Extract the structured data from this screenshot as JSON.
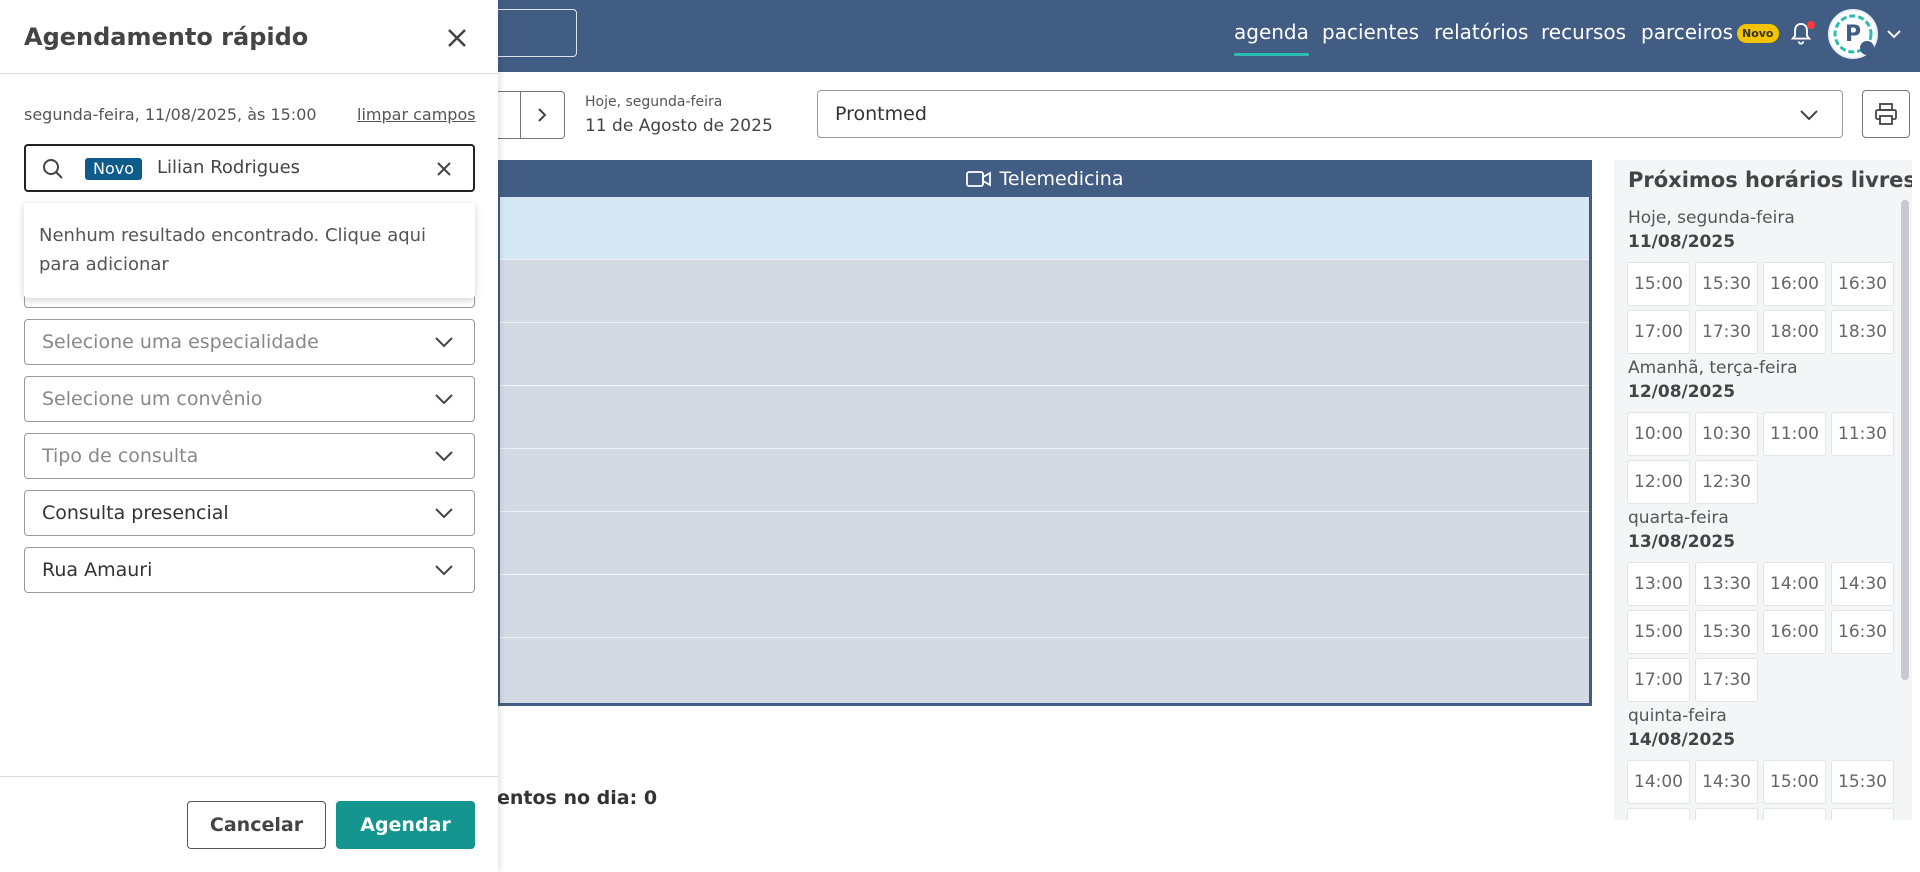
{
  "topnav": {
    "items": [
      "agenda",
      "pacientes",
      "relatórios",
      "recursos",
      "parceiros"
    ],
    "new_badge": "Novo"
  },
  "toolbar": {
    "today_label": "Hoje, segunda-feira",
    "today_date": "11 de Agosto de 2025",
    "clinic": "Prontmed"
  },
  "calendar": {
    "header": "Telemedicina",
    "day_count": "entos no dia: 0"
  },
  "free_slots": {
    "title": "Próximos horários livres",
    "days": [
      {
        "label": "Hoje, segunda-feira",
        "date": "11/08/2025",
        "times": [
          "15:00",
          "15:30",
          "16:00",
          "16:30",
          "17:00",
          "17:30",
          "18:00",
          "18:30"
        ]
      },
      {
        "label": "Amanhã, terça-feira",
        "date": "12/08/2025",
        "times": [
          "10:00",
          "10:30",
          "11:00",
          "11:30",
          "12:00",
          "12:30"
        ]
      },
      {
        "label": "quarta-feira",
        "date": "13/08/2025",
        "times": [
          "13:00",
          "13:30",
          "14:00",
          "14:30",
          "15:00",
          "15:30",
          "16:00",
          "16:30",
          "17:00",
          "17:30"
        ]
      },
      {
        "label": "quinta-feira",
        "date": "14/08/2025",
        "times": [
          "14:00",
          "14:30",
          "15:00",
          "15:30"
        ]
      }
    ]
  },
  "modal": {
    "title": "Agendamento rápido",
    "slot_info": "segunda-feira, 11/08/2025, às 15:00",
    "clear_fields": "limpar campos",
    "search": {
      "tag": "Novo",
      "value": "Lilian Rodrigues"
    },
    "no_result": "Nenhum resultado encontrado. Clique aqui para adicionar",
    "fields": {
      "specialty_placeholder": "Selecione uma especialidade",
      "insurance_placeholder": "Selecione um convênio",
      "type_placeholder": "Tipo de consulta",
      "mode_value": "Consulta presencial",
      "location_value": "Rua Amauri"
    },
    "cancel": "Cancelar",
    "submit": "Agendar"
  },
  "colors": {
    "nav_bg": "#425d84",
    "accent": "#15958f",
    "new_tag": "#0d5c8c",
    "badge": "#f5c400"
  }
}
